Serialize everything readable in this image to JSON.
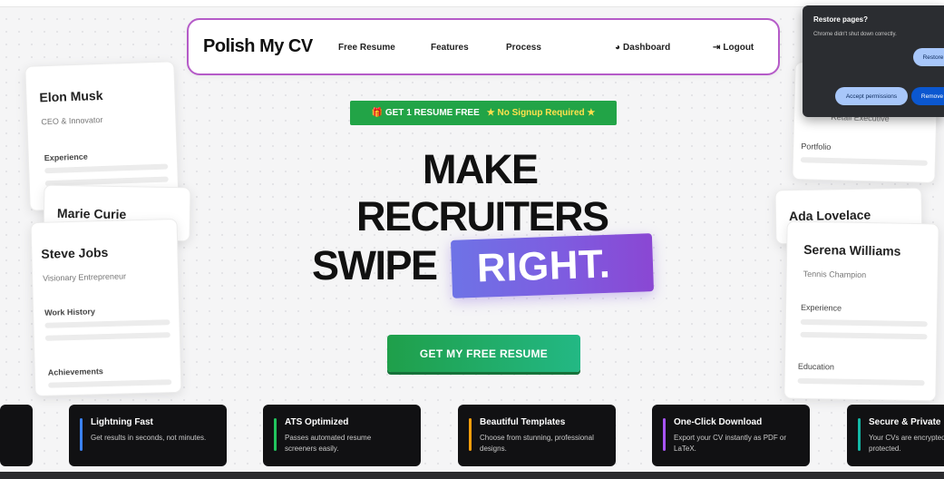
{
  "navbar": {
    "logo": "Polish My CV",
    "links": [
      "Free Resume",
      "Features",
      "Process"
    ],
    "dashboard": "Dashboard",
    "logout": "Logout"
  },
  "promo": {
    "gift_icon": "🎁",
    "main": "GET 1 RESUME FREE",
    "secondary": "★ No Signup Required ★"
  },
  "hero": {
    "line1": "MAKE",
    "line2": "RECRUITERS",
    "line3": "SWIPE",
    "highlight": "RIGHT.",
    "cta": "GET MY FREE RESUME"
  },
  "cards": {
    "elon": {
      "name": "Elon Musk",
      "role": "CEO & Innovator",
      "section": "Experience"
    },
    "marie": {
      "name": "Marie Curie"
    },
    "steve": {
      "name": "Steve Jobs",
      "role": "Visionary Entrepreneur",
      "section1": "Work History",
      "section2": "Achievements"
    },
    "right_top": {
      "role": "Retail Executive",
      "section": "Portfolio"
    },
    "ada": {
      "name": "Ada Lovelace"
    },
    "serena": {
      "name": "Serena Williams",
      "role": "Tennis Champion",
      "section1": "Experience",
      "section2": "Education"
    }
  },
  "features": [
    {
      "title": "Lightning Fast",
      "desc": "Get results in seconds, not minutes.",
      "color": "#3b82f6"
    },
    {
      "title": "ATS Optimized",
      "desc": "Passes automated resume screeners easily.",
      "color": "#22c55e"
    },
    {
      "title": "Beautiful Templates",
      "desc": "Choose from stunning, professional designs.",
      "color": "#f59e0b"
    },
    {
      "title": "One-Click Download",
      "desc": "Export your CV instantly as PDF or LaTeX.",
      "color": "#a855f7"
    },
    {
      "title": "Secure & Private",
      "desc": "Your CVs are encrypted and protected.",
      "color": "#14b8a6"
    }
  ],
  "restore_popup": {
    "title": "Restore pages?",
    "desc": "Chrome didn't shut down correctly.",
    "restore_button": "Restore",
    "accept_button": "Accept permissions",
    "remove_button": "Remove"
  }
}
